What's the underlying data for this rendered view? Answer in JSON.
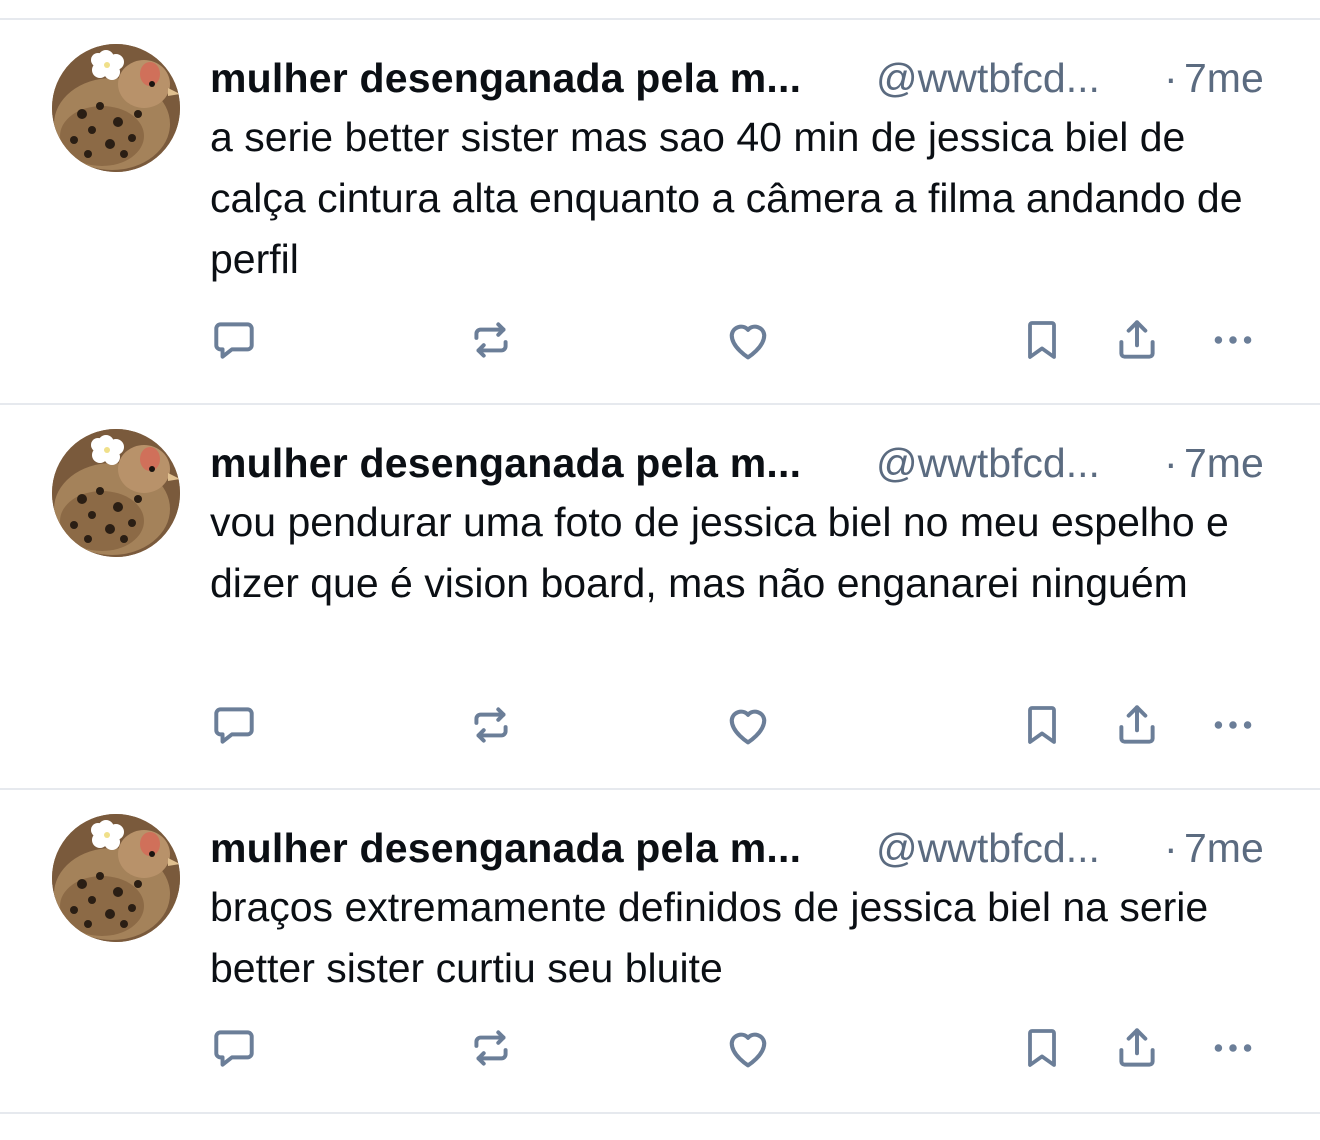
{
  "colors": {
    "text": "#0b0f14",
    "muted": "#5b6b80",
    "icon": "#6b7e98",
    "divider": "#e6e9ee",
    "background": "#ffffff"
  },
  "posts": [
    {
      "author_name": "mulher desenganada pela m...",
      "handle": "@wwtbfcd...",
      "separator": "·",
      "timestamp": "7me",
      "text": "a serie better sister mas sao 40 min de jessica biel de calça cintura alta enquanto a câmera a filma andando de perfil",
      "avatar_icon": "bird-avatar",
      "action_icons": [
        "reply-icon",
        "repost-icon",
        "like-icon",
        "bookmark-icon",
        "share-icon",
        "more-icon"
      ]
    },
    {
      "author_name": "mulher desenganada pela m...",
      "handle": "@wwtbfcd...",
      "separator": "·",
      "timestamp": "7me",
      "text": "vou pendurar uma foto de jessica biel no meu espelho e dizer que é vision board, mas não enganarei ninguém",
      "avatar_icon": "bird-avatar",
      "action_icons": [
        "reply-icon",
        "repost-icon",
        "like-icon",
        "bookmark-icon",
        "share-icon",
        "more-icon"
      ]
    },
    {
      "author_name": "mulher desenganada pela m...",
      "handle": "@wwtbfcd...",
      "separator": "·",
      "timestamp": "7me",
      "text": "braços extremamente definidos de jessica biel na serie better sister curtiu seu bluite",
      "avatar_icon": "bird-avatar",
      "action_icons": [
        "reply-icon",
        "repost-icon",
        "like-icon",
        "bookmark-icon",
        "share-icon",
        "more-icon"
      ]
    }
  ]
}
